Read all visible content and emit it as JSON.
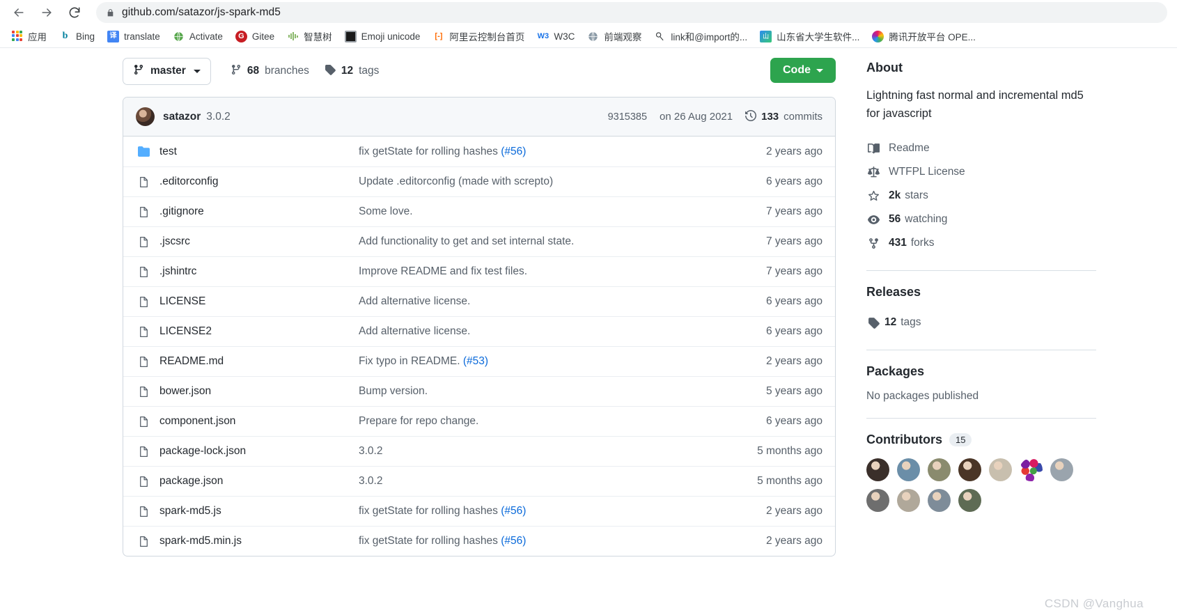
{
  "browser": {
    "back_label": "Back",
    "forward_label": "Forward",
    "reload_label": "Reload",
    "lock_icon": "lock-icon",
    "url": "github.com/satazor/js-spark-md5",
    "bookmarks": [
      {
        "label": "应用",
        "icon": "apps-grid-icon"
      },
      {
        "label": "Bing",
        "icon": "bing-icon"
      },
      {
        "label": "translate",
        "icon": "translate-icon"
      },
      {
        "label": "Activate",
        "icon": "globe-icon"
      },
      {
        "label": "Gitee",
        "icon": "gitee-icon"
      },
      {
        "label": "智慧树",
        "icon": "wave-icon"
      },
      {
        "label": "Emoji unicode",
        "icon": "emoji-icon"
      },
      {
        "label": "阿里云控制台首页",
        "icon": "aliyun-icon"
      },
      {
        "label": "W3C",
        "icon": "w3c-icon"
      },
      {
        "label": "前端观察",
        "icon": "globe-icon"
      },
      {
        "label": "link和@import的...",
        "icon": "link-icon"
      },
      {
        "label": "山东省大学生软件...",
        "icon": "shandong-icon"
      },
      {
        "label": "腾讯开放平台 OPE...",
        "icon": "tencent-icon"
      }
    ]
  },
  "repo": {
    "branch": "master",
    "branches_count": "68",
    "branches_label": "branches",
    "tags_count": "12",
    "tags_label": "tags",
    "code_button": "Code",
    "latest_commit": {
      "author": "satazor",
      "message": "3.0.2",
      "sha": "9315385",
      "date": "on 26 Aug 2021",
      "commits_count": "133",
      "commits_label": "commits"
    },
    "files": [
      {
        "name": "test",
        "type": "folder",
        "message": "fix getState for rolling hashes ",
        "ref": "(#56)",
        "age": "2 years ago"
      },
      {
        "name": ".editorconfig",
        "type": "file",
        "message": "Update .editorconfig (made with screpto)",
        "ref": "",
        "age": "6 years ago"
      },
      {
        "name": ".gitignore",
        "type": "file",
        "message": "Some love.",
        "ref": "",
        "age": "7 years ago"
      },
      {
        "name": ".jscsrc",
        "type": "file",
        "message": "Add functionality to get and set internal state.",
        "ref": "",
        "age": "7 years ago"
      },
      {
        "name": ".jshintrc",
        "type": "file",
        "message": "Improve README and fix test files.",
        "ref": "",
        "age": "7 years ago"
      },
      {
        "name": "LICENSE",
        "type": "file",
        "message": "Add alternative license.",
        "ref": "",
        "age": "6 years ago"
      },
      {
        "name": "LICENSE2",
        "type": "file",
        "message": "Add alternative license.",
        "ref": "",
        "age": "6 years ago"
      },
      {
        "name": "README.md",
        "type": "file",
        "message": "Fix typo in README. ",
        "ref": "(#53)",
        "age": "2 years ago"
      },
      {
        "name": "bower.json",
        "type": "file",
        "message": "Bump version.",
        "ref": "",
        "age": "5 years ago"
      },
      {
        "name": "component.json",
        "type": "file",
        "message": "Prepare for repo change.",
        "ref": "",
        "age": "6 years ago"
      },
      {
        "name": "package-lock.json",
        "type": "file",
        "message": "3.0.2",
        "ref": "",
        "age": "5 months ago"
      },
      {
        "name": "package.json",
        "type": "file",
        "message": "3.0.2",
        "ref": "",
        "age": "5 months ago"
      },
      {
        "name": "spark-md5.js",
        "type": "file",
        "message": "fix getState for rolling hashes ",
        "ref": "(#56)",
        "age": "2 years ago"
      },
      {
        "name": "spark-md5.min.js",
        "type": "file",
        "message": "fix getState for rolling hashes ",
        "ref": "(#56)",
        "age": "2 years ago"
      }
    ]
  },
  "sidebar": {
    "about_title": "About",
    "description": "Lightning fast normal and incremental md5 for javascript",
    "meta": [
      {
        "icon": "book-icon",
        "text": "Readme",
        "value": "",
        "label": "Readme"
      },
      {
        "icon": "law-icon",
        "text": "WTFPL License",
        "value": "",
        "label": "WTFPL License"
      },
      {
        "icon": "star-icon",
        "value": "2k",
        "label": "stars"
      },
      {
        "icon": "eye-icon",
        "value": "56",
        "label": "watching"
      },
      {
        "icon": "fork-icon",
        "value": "431",
        "label": "forks"
      }
    ],
    "releases_title": "Releases",
    "releases_tags_count": "12",
    "releases_tags_label": "tags",
    "packages_title": "Packages",
    "packages_empty": "No packages published",
    "contributors_title": "Contributors",
    "contributors_count": "15",
    "contributor_avatars": [
      "#3a2f2a",
      "#6b8ea8",
      "#8a8b6e",
      "#4a3526",
      "#c8bfae",
      "#8e3fbe",
      "#9aa4ad",
      "#6e6e6e",
      "#b0a89a",
      "#7e8c99",
      "#5e6b54"
    ]
  },
  "watermark": "CSDN @Vanghua"
}
